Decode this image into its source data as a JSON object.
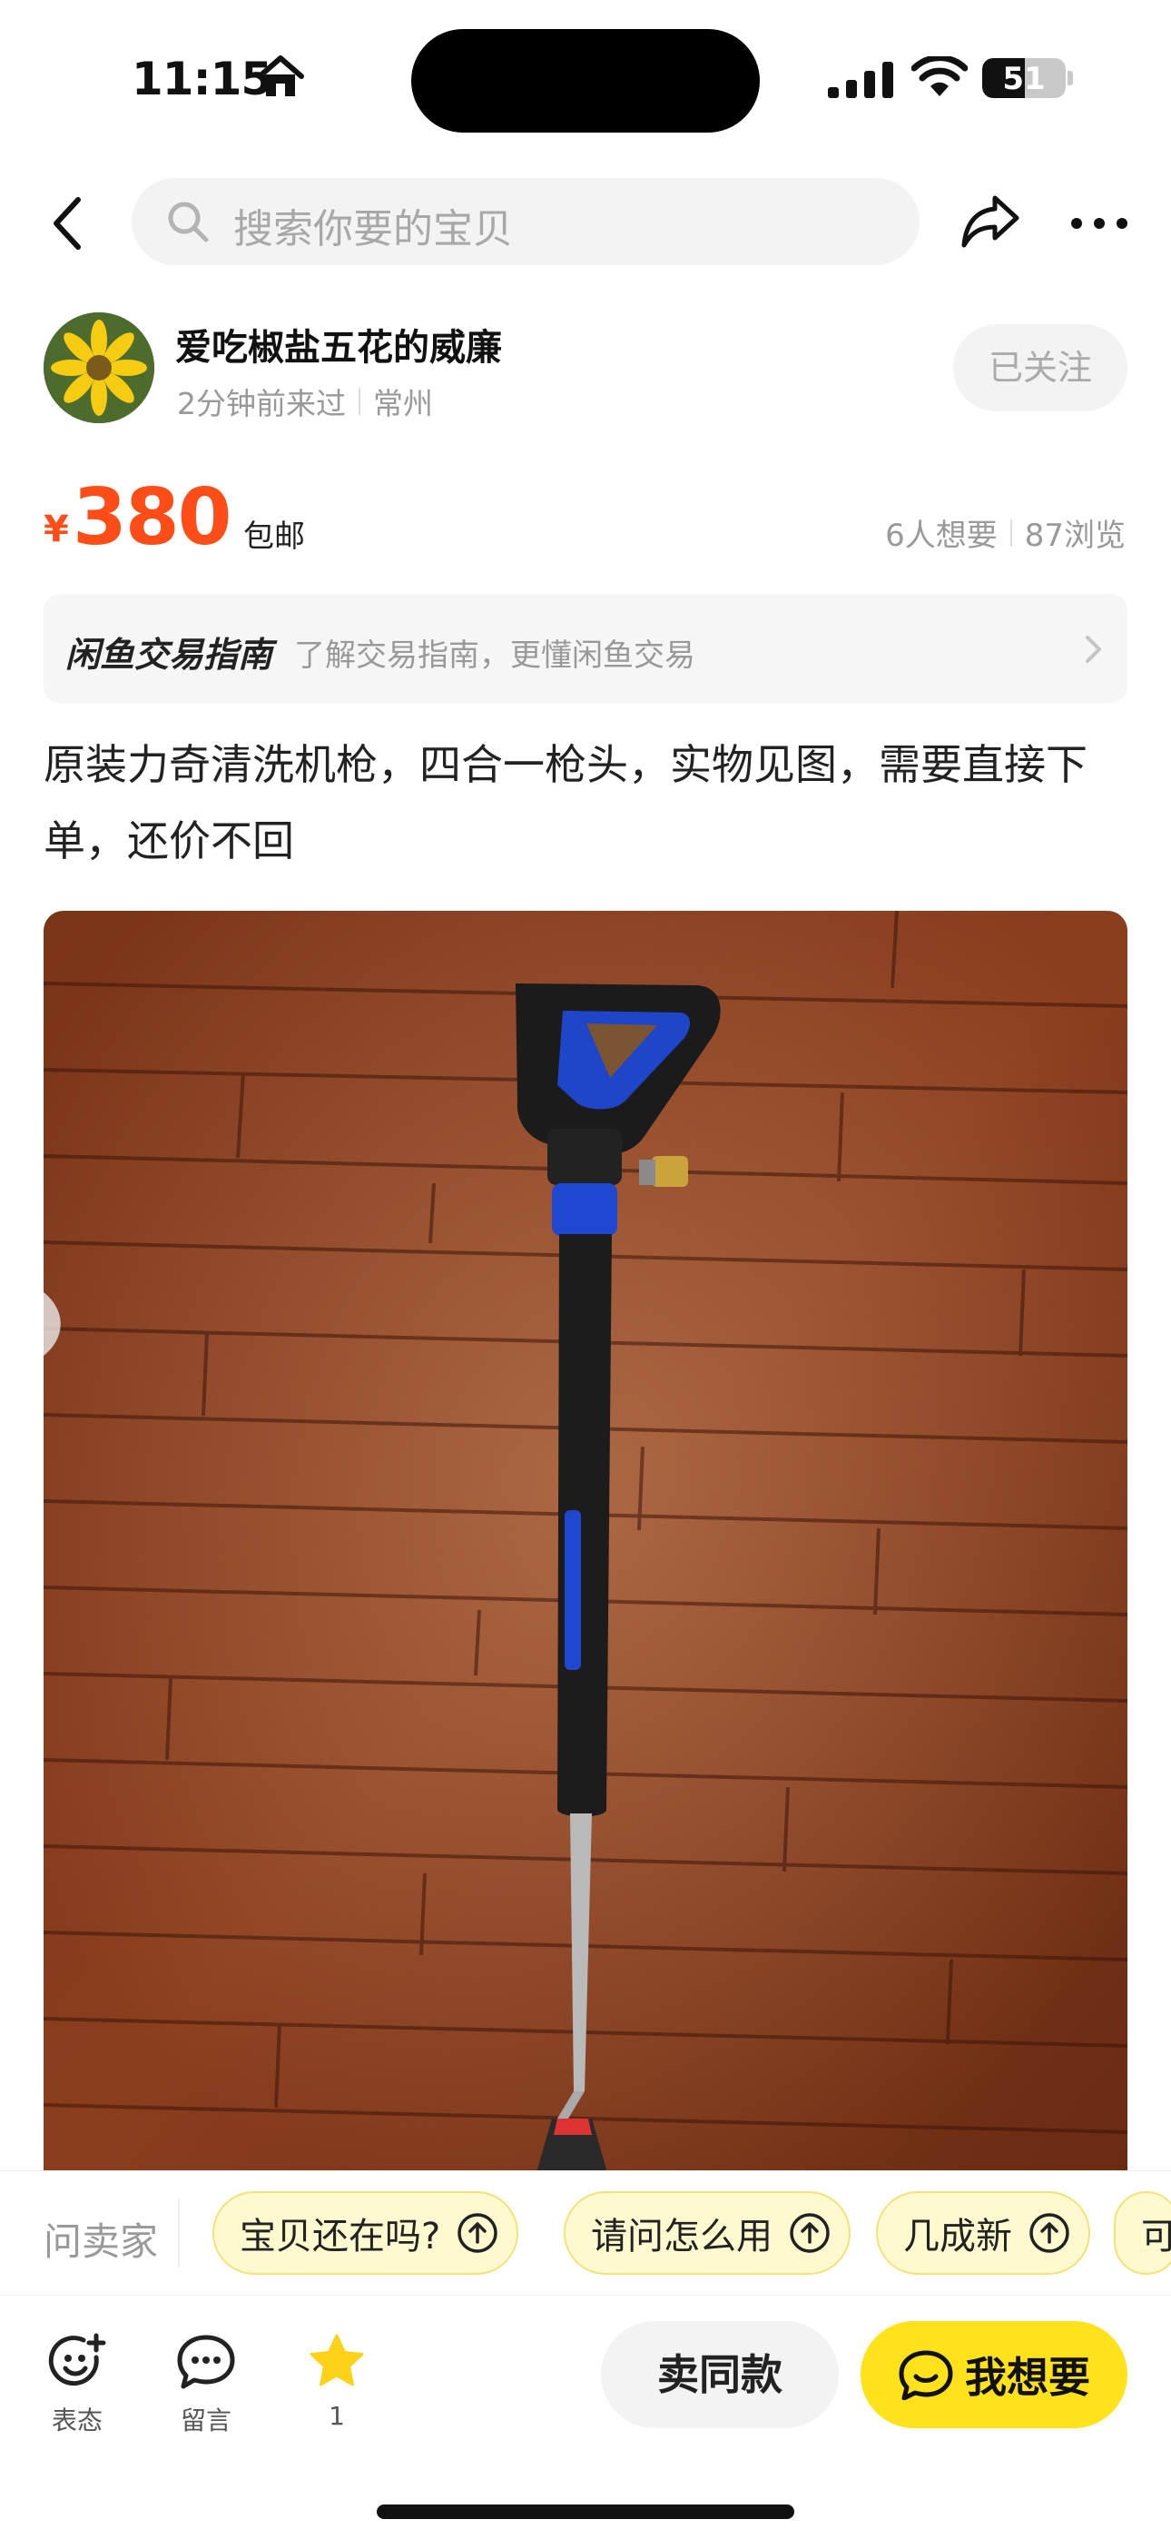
{
  "status_bar": {
    "time": "11:15",
    "battery": "51",
    "battery_level_percent": 51
  },
  "nav": {
    "search_placeholder": "搜索你要的宝贝"
  },
  "seller": {
    "name": "爱吃椒盐五花的威廉",
    "last_seen": "2分钟前来过",
    "location": "常州",
    "follow_label": "已关注"
  },
  "price": {
    "currency": "¥",
    "amount": "380",
    "shipping": "包邮",
    "wants": "6人想要",
    "views": "87浏览",
    "color": "#ff4d17"
  },
  "guide": {
    "brand": "闲鱼交易指南",
    "text": "了解交易指南，更懂闲鱼交易"
  },
  "description": "原装力奇清洗机枪，四合一枪头，实物见图，需要直接下单，还价不回",
  "ask": {
    "label": "问卖家",
    "chips": [
      "宝贝还在吗?",
      "请问怎么用",
      "几成新",
      "可"
    ]
  },
  "toolbar": {
    "react_label": "表态",
    "comment_label": "留言",
    "fav_count": "1",
    "same_label": "卖同款",
    "want_label": "我想要",
    "accent": "#ffe21a"
  }
}
